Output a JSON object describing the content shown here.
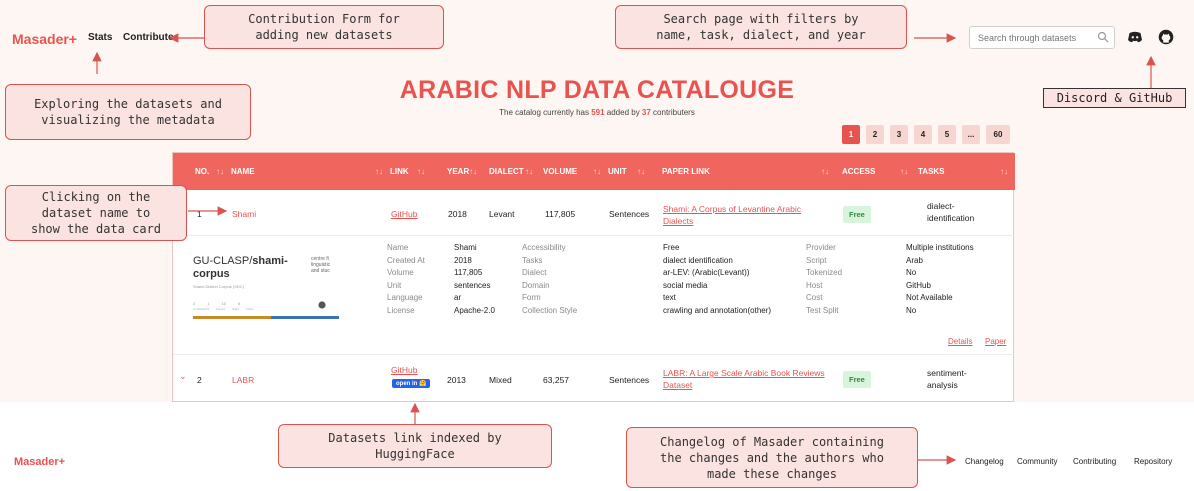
{
  "header": {
    "brand": "Masader+",
    "nav": [
      "Stats",
      "Contribute"
    ],
    "search_placeholder": "Search through datasets",
    "icons": [
      "discord-icon",
      "github-icon"
    ]
  },
  "hero": {
    "title": "ARABIC NLP DATA CATALOUGE",
    "subtitle_pre": "The catalog currently has ",
    "count": "591",
    "subtitle_mid": " added by ",
    "contributors": "37",
    "subtitle_post": " contributers"
  },
  "pagination": [
    "1",
    "2",
    "3",
    "4",
    "5",
    "...",
    "60"
  ],
  "table": {
    "columns": [
      "NO.",
      "NAME",
      "LINK",
      "YEAR",
      "DIALECT",
      "VOLUME",
      "UNIT",
      "PAPER LINK",
      "ACCESS",
      "TASKS"
    ],
    "rows": [
      {
        "no": "1",
        "name": "Shami",
        "link": "GitHub",
        "year": "2018",
        "dialect": "Levant",
        "volume": "117,805",
        "unit": "Sentences",
        "paper_line1": "Shami: A Corpus of Levantine Arabic",
        "paper_line2": "Dialects",
        "access": "Free",
        "task_line1": "dialect-",
        "task_line2": "identification"
      },
      {
        "no": "2",
        "name": "LABR",
        "link": "GitHub",
        "hf_badge": "open in 🤗",
        "year": "2013",
        "dialect": "Mixed",
        "volume": "63,257",
        "unit": "Sentences",
        "paper_line1": "LABR: A Large Scale Arabic Book Reviews",
        "paper_line2": "Dataset",
        "access": "Free",
        "task_line1": "sentiment-",
        "task_line2": "analysis"
      }
    ]
  },
  "datacard": {
    "preview": {
      "repo_owner": "GU-CLASP/",
      "repo_name_bold": "shami-",
      "repo_name_line2": "corpus",
      "description": "Shami Dialect Corpus (SDC)",
      "side_text": [
        "centre fi",
        "linguistic",
        "and stuc"
      ],
      "stats": [
        "2",
        "1",
        "10",
        "6"
      ],
      "stat_labels": [
        "Contributors",
        "Issues",
        "Stars",
        "Forks"
      ]
    },
    "col1_keys": [
      "Name",
      "Created At",
      "Volume",
      "Unit",
      "Language",
      "License"
    ],
    "col1_vals": [
      "Shami",
      "2018",
      "117,805",
      "sentences",
      "ar",
      "Apache-2.0"
    ],
    "col2_keys": [
      "Accessibility",
      "Tasks",
      "Dialect",
      "Domain",
      "Form",
      "Collection Style"
    ],
    "col2_vals": [
      "Free",
      "dialect identification",
      "ar-LEV: (Arabic(Levant))",
      "social media",
      "text",
      "crawling and annotation(other)"
    ],
    "col3_keys": [
      "Provider",
      "Script",
      "Tokenized",
      "Host",
      "Cost",
      "Test Split"
    ],
    "col3_vals": [
      "Multiple institutions",
      "Arab",
      "No",
      "GitHub",
      "Not Available",
      "No"
    ],
    "links": [
      "Details",
      "Paper"
    ]
  },
  "footer": {
    "brand": "Masader+",
    "links": [
      "Changelog",
      "Community",
      "Contributing",
      "Repository"
    ]
  },
  "annotations": {
    "contribution": [
      "Contribution Form for",
      "adding new datasets"
    ],
    "search": [
      "Search page with filters by",
      "name, task, dialect, and year"
    ],
    "discord": "Discord & GitHub",
    "exploring": [
      "Exploring the datasets and",
      "visualizing the metadata"
    ],
    "clicking": [
      "Clicking on the",
      "dataset name to",
      "show the data card"
    ],
    "huggingface": [
      "Datasets link indexed by",
      "HuggingFace"
    ],
    "changelog": [
      "Changelog of Masader containing",
      "the changes and the authors who",
      "made these changes"
    ]
  },
  "colors": {
    "accent": "#e8534f",
    "header_row": "#f0665f",
    "free_badge": "#d9f4dc",
    "callout_bg": "#fbe3e1"
  }
}
